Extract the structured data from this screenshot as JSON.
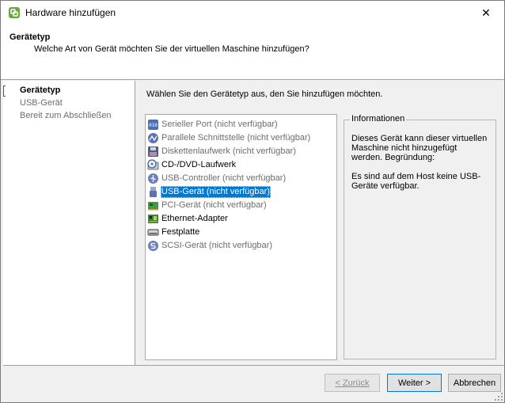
{
  "window": {
    "title": "Hardware hinzufügen",
    "close_glyph": "✕"
  },
  "header": {
    "title": "Gerätetyp",
    "subtitle": "Welche Art von Gerät möchten Sie der virtuellen Maschine hinzufügen?"
  },
  "steps": [
    {
      "label": "Gerätetyp",
      "state": "active"
    },
    {
      "label": "USB-Gerät",
      "state": "future"
    },
    {
      "label": "Bereit zum Abschließen",
      "state": "future"
    }
  ],
  "content": {
    "instruction": "Wählen Sie den Gerätetyp aus, den Sie hinzufügen möchten."
  },
  "devices": [
    {
      "label": "Serieller Port (nicht verfügbar)",
      "icon": "serial-port-icon",
      "enabled": false,
      "selected": false
    },
    {
      "label": "Parallele Schnittstelle (nicht verfügbar)",
      "icon": "parallel-port-icon",
      "enabled": false,
      "selected": false
    },
    {
      "label": "Diskettenlaufwerk (nicht verfügbar)",
      "icon": "floppy-icon",
      "enabled": false,
      "selected": false
    },
    {
      "label": "CD-/DVD-Laufwerk",
      "icon": "cd-dvd-icon",
      "enabled": true,
      "selected": false
    },
    {
      "label": "USB-Controller (nicht verfügbar)",
      "icon": "usb-controller-icon",
      "enabled": false,
      "selected": false
    },
    {
      "label": "USB-Gerät (nicht verfügbar)",
      "icon": "usb-device-icon",
      "enabled": false,
      "selected": true
    },
    {
      "label": "PCI-Gerät (nicht verfügbar)",
      "icon": "pci-device-icon",
      "enabled": false,
      "selected": false
    },
    {
      "label": "Ethernet-Adapter",
      "icon": "ethernet-adapter-icon",
      "enabled": true,
      "selected": false
    },
    {
      "label": "Festplatte",
      "icon": "hard-disk-icon",
      "enabled": true,
      "selected": false
    },
    {
      "label": "SCSI-Gerät (nicht verfügbar)",
      "icon": "scsi-device-icon",
      "enabled": false,
      "selected": false
    }
  ],
  "info": {
    "legend": "Informationen",
    "paragraph1": "Dieses Gerät kann dieser virtuellen Maschine nicht hinzugefügt werden. Begründung:",
    "paragraph2": "Es sind auf dem Host keine USB-Geräte verfügbar."
  },
  "buttons": {
    "back": "< Zurück",
    "next": "Weiter >",
    "cancel": "Abbrechen"
  },
  "colors": {
    "selection": "#0078d7",
    "disabled_text": "#6d6d6d",
    "dialog_bg": "#f0f0f0"
  }
}
